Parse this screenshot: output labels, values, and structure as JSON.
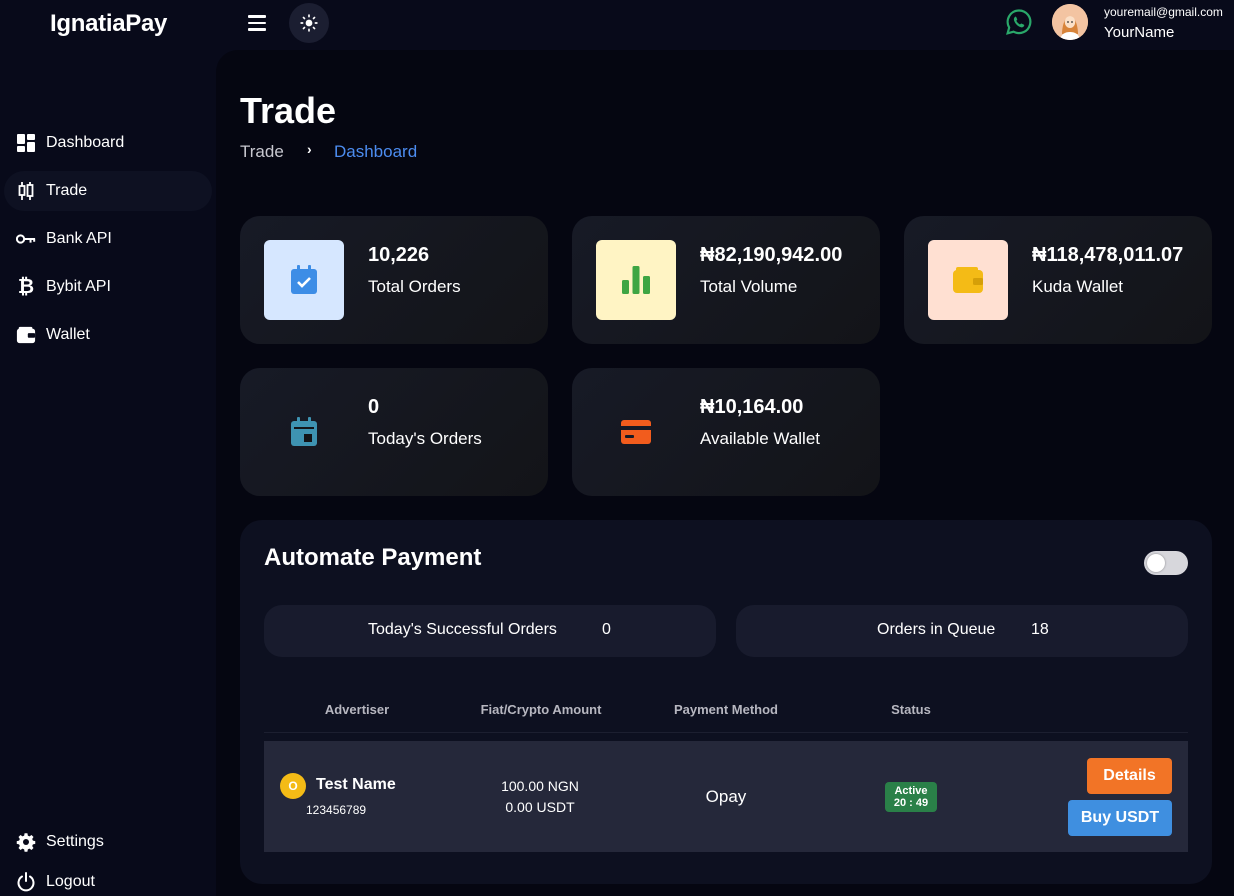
{
  "app": {
    "brand": "IgnatiaPay"
  },
  "header": {
    "menu_icon": "hamburger-icon",
    "theme_icon": "sun-icon",
    "chat_icon": "whatsapp-icon",
    "user_email": "youremail@gmail.com",
    "user_name": "YourName"
  },
  "sidebar": {
    "items": [
      {
        "label": "Dashboard",
        "icon": "dashboard-icon"
      },
      {
        "label": "Trade",
        "icon": "candlestick-icon",
        "active": true
      },
      {
        "label": "Bank API",
        "icon": "key-icon"
      },
      {
        "label": "Bybit API",
        "icon": "bitcoin-icon"
      },
      {
        "label": "Wallet",
        "icon": "wallet-icon"
      }
    ],
    "footer": [
      {
        "label": "Settings",
        "icon": "gear-icon"
      },
      {
        "label": "Logout",
        "icon": "power-icon"
      }
    ]
  },
  "page": {
    "title": "Trade",
    "breadcrumb": [
      "Trade",
      "Dashboard"
    ]
  },
  "cards": [
    {
      "value": "10,226",
      "caption": "Total Orders",
      "icon": "calendar-check-icon",
      "tile_color": "#d6e7ff",
      "icon_color": "#3d8de6"
    },
    {
      "value": "₦82,190,942.00",
      "caption": "Total Volume",
      "icon": "bar-chart-icon",
      "tile_color": "#fff4c4",
      "icon_color": "#3ea543"
    },
    {
      "value": "₦118,478,011.07",
      "caption": "Kuda Wallet",
      "icon": "wallet-icon",
      "tile_color": "#ffe0d2",
      "icon_color": "#f4bb16"
    },
    {
      "value": "0",
      "caption": "Today's Orders",
      "icon": "calendar-icon",
      "icon_color": "#3e93b2"
    },
    {
      "value": "₦10,164.00",
      "caption": "Available Wallet",
      "icon": "credit-card-icon",
      "icon_color": "#f25c1d"
    }
  ],
  "automate": {
    "title": "Automate Payment",
    "toggle_on": false,
    "stats": [
      {
        "label": "Today's Successful Orders",
        "value": "0"
      },
      {
        "label": "Orders in Queue",
        "value": "18"
      }
    ],
    "columns": [
      "Advertiser",
      "Fiat/Crypto Amount",
      "Payment Method",
      "Status"
    ],
    "rows": [
      {
        "avatar_letter": "O",
        "name": "Test Name",
        "id": "123456789",
        "fiat": "100.00 NGN",
        "crypto": "0.00 USDT",
        "method": "Opay",
        "status": "Active",
        "timer": "20 : 49",
        "details_label": "Details",
        "buy_label": "Buy USDT"
      }
    ]
  }
}
